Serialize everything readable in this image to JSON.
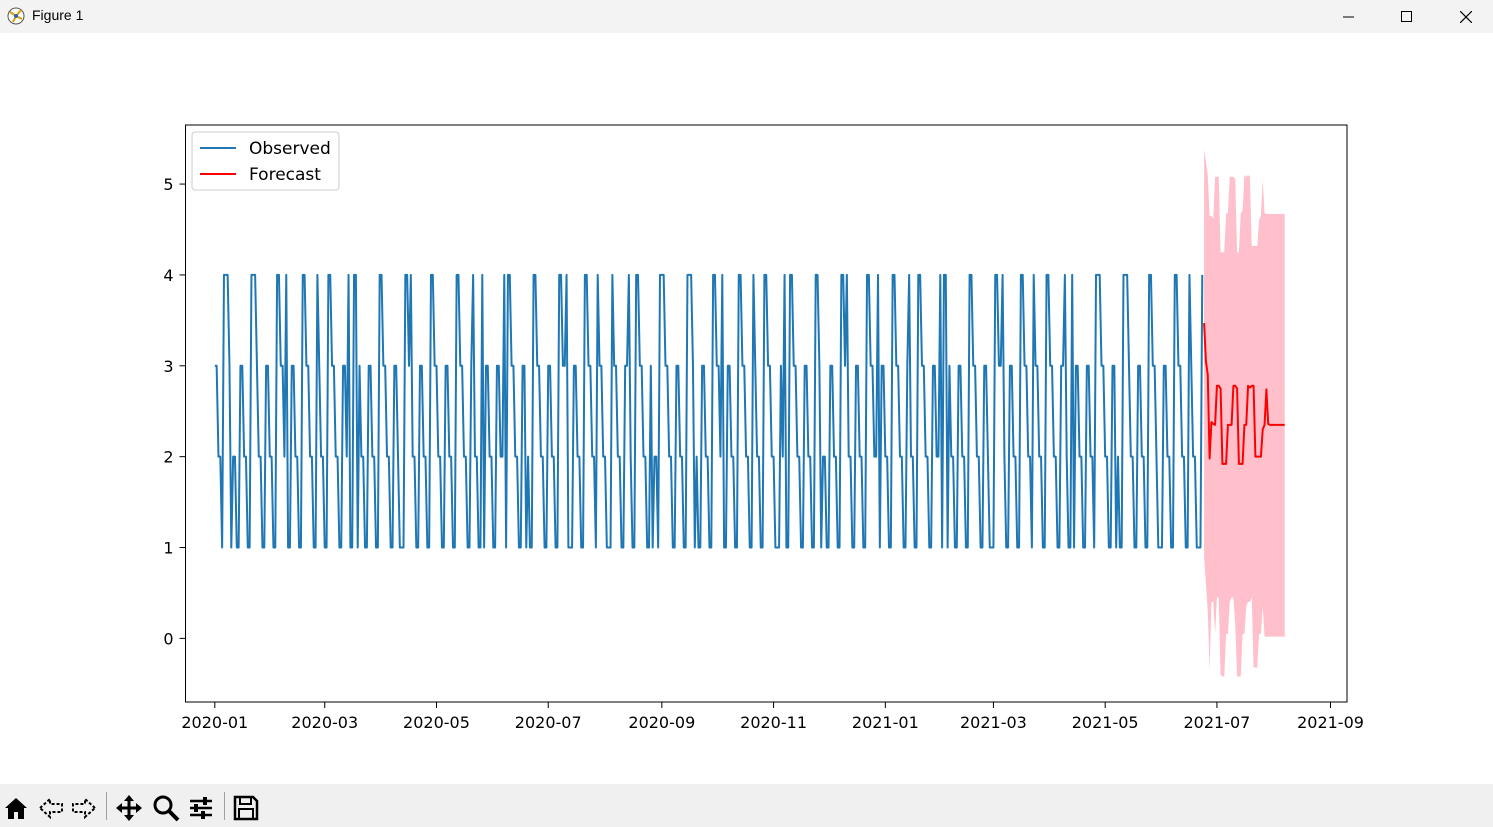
{
  "window": {
    "title": "Figure 1",
    "controls": [
      "minimize",
      "maximize",
      "close"
    ]
  },
  "toolbar": {
    "buttons": [
      {
        "name": "home",
        "icon": "home-icon"
      },
      {
        "name": "back",
        "icon": "back-arrow-icon"
      },
      {
        "name": "forward",
        "icon": "forward-arrow-icon"
      },
      {
        "name": "pan",
        "icon": "move-icon"
      },
      {
        "name": "zoom",
        "icon": "zoom-icon"
      },
      {
        "name": "configure",
        "icon": "sliders-icon"
      },
      {
        "name": "save",
        "icon": "save-icon"
      }
    ]
  },
  "chart_data": {
    "type": "line",
    "title": "",
    "xlabel": "",
    "ylabel": "",
    "x_range": [
      "2019-12-16",
      "2021-09-10"
    ],
    "ylim": [
      -0.7,
      5.65
    ],
    "x_ticks": [
      "2020-01",
      "2020-03",
      "2020-05",
      "2020-07",
      "2020-09",
      "2020-11",
      "2021-01",
      "2021-03",
      "2021-05",
      "2021-07",
      "2021-09"
    ],
    "y_ticks": [
      "0",
      "1",
      "2",
      "3",
      "4",
      "5"
    ],
    "grid": false,
    "legend": {
      "position": "top-left",
      "entries": [
        "Observed",
        "Forecast"
      ]
    },
    "colors": {
      "observed": "#1f77b4",
      "forecast": "#ff0000",
      "interval": "#ffc0cb"
    },
    "series": [
      {
        "name": "Observed",
        "start": "2020-01-01",
        "step": "1D",
        "pattern_note_free": true,
        "weekly_cycle_values": [
          3,
          3,
          2,
          2,
          1,
          1,
          4,
          4,
          3,
          3,
          2,
          2,
          1,
          1
        ]
      },
      {
        "name": "Forecast",
        "x": [
          "2021-06-24",
          "2021-06-25",
          "2021-06-26",
          "2021-06-27",
          "2021-06-28",
          "2021-06-29",
          "2021-06-30",
          "2021-07-01",
          "2021-07-02",
          "2021-07-03",
          "2021-07-04",
          "2021-07-05",
          "2021-07-06",
          "2021-07-07",
          "2021-07-08",
          "2021-07-09",
          "2021-07-10",
          "2021-07-11",
          "2021-07-12",
          "2021-07-13",
          "2021-07-14",
          "2021-07-15",
          "2021-07-16",
          "2021-07-17",
          "2021-07-18",
          "2021-07-19",
          "2021-07-20",
          "2021-07-21",
          "2021-07-22",
          "2021-07-23",
          "2021-07-24",
          "2021-07-25",
          "2021-07-26",
          "2021-07-27",
          "2021-07-28",
          "2021-07-29",
          "2021-07-30",
          "2021-07-31",
          "2021-08-01",
          "2021-08-02",
          "2021-08-03",
          "2021-08-04",
          "2021-08-05",
          "2021-08-06",
          "2021-08-07"
        ],
        "values": [
          3.47,
          3.05,
          2.9,
          1.98,
          2.38,
          2.36,
          2.35,
          2.78,
          2.78,
          2.75,
          1.92,
          1.92,
          1.92,
          2.35,
          2.35,
          2.35,
          2.78,
          2.78,
          2.75,
          1.92,
          1.92,
          1.92,
          2.35,
          2.35,
          2.78,
          2.76,
          2.78,
          2.78,
          2.0,
          2.0,
          2.0,
          2.0,
          2.3,
          2.35,
          2.74,
          2.36,
          2.35,
          2.35,
          2.35,
          2.35,
          2.35,
          2.35,
          2.35,
          2.35,
          2.35
        ],
        "lower": [
          0.9,
          0.6,
          0.3,
          -0.35,
          0.4,
          0.4,
          0.05,
          0.45,
          0.45,
          -0.4,
          -0.42,
          -0.42,
          0.05,
          0.05,
          0.4,
          0.45,
          0.45,
          0.15,
          -0.42,
          -0.42,
          -0.42,
          0.05,
          0.05,
          0.35,
          0.4,
          0.4,
          0.45,
          -0.32,
          -0.32,
          -0.32,
          0.05,
          0.05,
          0.35,
          0.02,
          0.02,
          0.02,
          0.02,
          0.02,
          0.02,
          0.02,
          0.02,
          0.02,
          0.02,
          0.02,
          0.02
        ],
        "upper": [
          5.38,
          5.25,
          5.1,
          4.65,
          4.65,
          4.62,
          5.08,
          5.08,
          5.08,
          4.25,
          4.25,
          4.25,
          4.68,
          4.68,
          5.08,
          5.08,
          5.08,
          5.05,
          4.25,
          4.25,
          4.68,
          4.7,
          5.1,
          5.08,
          5.1,
          5.08,
          4.32,
          4.32,
          4.32,
          4.32,
          4.6,
          4.65,
          5.05,
          4.68,
          4.67,
          4.67,
          4.67,
          4.67,
          4.67,
          4.67,
          4.67,
          4.67,
          4.67,
          4.67,
          4.67
        ]
      }
    ]
  }
}
